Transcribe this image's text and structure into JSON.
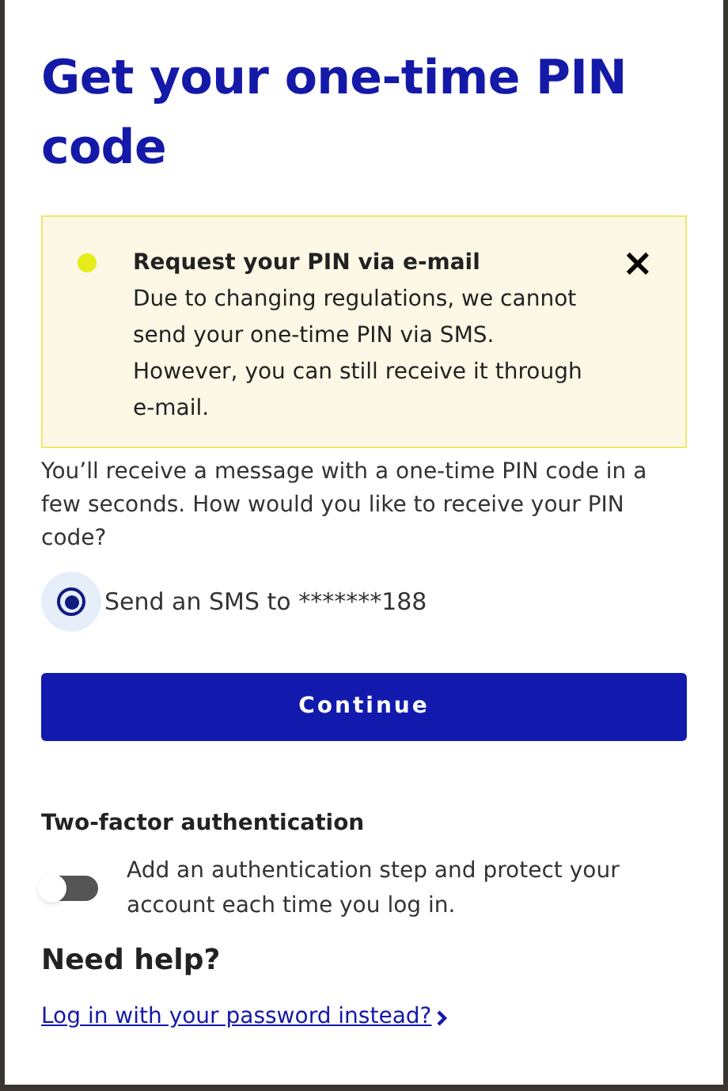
{
  "title": "Get your one-time PIN code",
  "alert": {
    "title": "Request your PIN via e-mail",
    "message": "Due to changing regulations, we cannot send your one-time PIN via SMS. However, you can still receive it through e-mail.",
    "close": "×"
  },
  "intro": "You’ll receive a message with a one-time PIN code in a few seconds. How would you like to receive your PIN code?",
  "options": [
    {
      "label": "Send an SMS to *******188",
      "selected": true
    }
  ],
  "continue_button": "Continue",
  "two_factor": {
    "heading": "Two-factor authentication",
    "description": "Add an authentication step and protect your account each time you log in.",
    "on": false
  },
  "help": {
    "heading": "Need help?",
    "link": "Log in with your password instead?"
  }
}
